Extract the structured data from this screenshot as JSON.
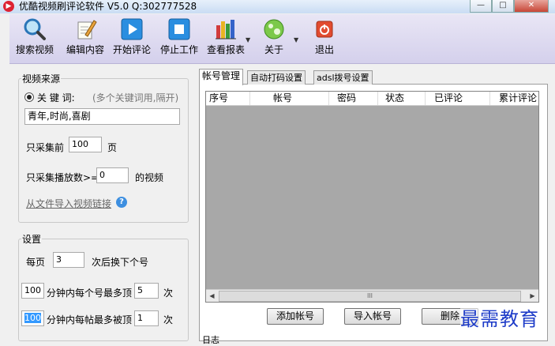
{
  "window": {
    "title": "优酷视频刷评论软件 V5.0  Q:302777528",
    "buttons": {
      "minimize": "—",
      "maximize": "□",
      "close": "✕"
    }
  },
  "toolbar": {
    "items": [
      {
        "label": "搜索视频",
        "icon": "magnifier-icon"
      },
      {
        "label": "编辑内容",
        "icon": "pencil-icon"
      },
      {
        "label": "开始评论",
        "icon": "play-icon"
      },
      {
        "label": "停止工作",
        "icon": "stop-icon"
      },
      {
        "label": "查看报表",
        "icon": "bar-chart-icon"
      },
      {
        "label": "关于",
        "icon": "globe-icon"
      },
      {
        "label": "退出",
        "icon": "power-icon"
      }
    ]
  },
  "video_source": {
    "title": "视频来源",
    "keyword_label": "关 键 词:",
    "keyword_hint": "(多个关键词用,隔开)",
    "keyword_value": "青年,时尚,喜剧",
    "collect_prefix": "只采集前",
    "collect_pages": "100",
    "collect_suffix": "页",
    "play_prefix": "只采集播放数>=",
    "play_count": "0",
    "play_suffix": "的视频",
    "import_link": "从文件导入视频链接",
    "help": "?"
  },
  "settings": {
    "title": "设置",
    "per_page_prefix": "每页",
    "per_page_value": "3",
    "per_page_suffix": "次后换下个号",
    "minutes1_value": "100",
    "minutes1_label": "分钟内每个号最多顶",
    "minutes1_count": "5",
    "minutes1_unit": "次",
    "minutes2_value": "100",
    "minutes2_label": "分钟内每帖最多被顶",
    "minutes2_count": "1",
    "minutes2_unit": "次"
  },
  "tabs": [
    {
      "label": "帐号管理",
      "active": true
    },
    {
      "label": "自动打码设置",
      "active": false
    },
    {
      "label": "adsl拨号设置",
      "active": false
    }
  ],
  "accounts_table": {
    "columns": [
      "序号",
      "帐号",
      "密码",
      "状态",
      "已评论",
      "累计评论"
    ],
    "rows": [],
    "scroll_thumb": "III"
  },
  "account_buttons": {
    "add": "添加帐号",
    "import": "导入帐号",
    "delete": "删除"
  },
  "log_label": "日志",
  "watermark": "最需教育",
  "colors": {
    "toolbar_bg": "#dcd8f0",
    "grid_bg": "#a8a8a8",
    "watermark": "#1e3cc8"
  }
}
